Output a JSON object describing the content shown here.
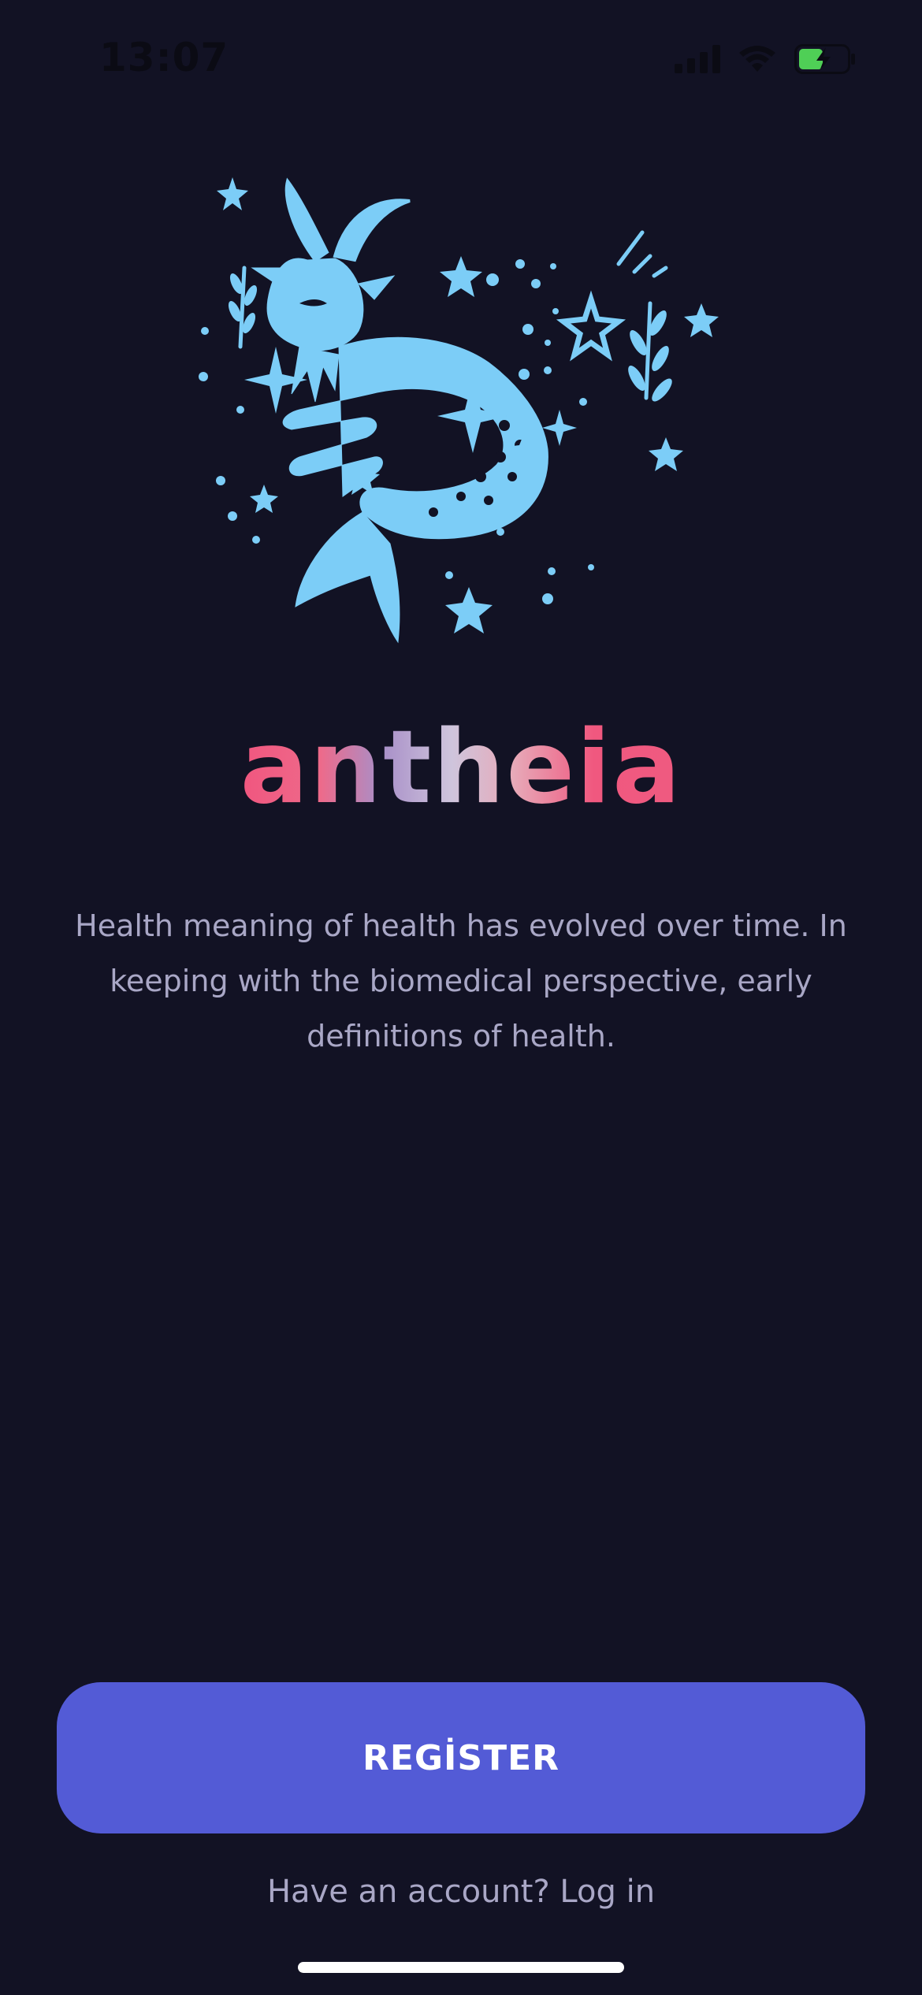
{
  "status_bar": {
    "time": "13:07"
  },
  "brand": {
    "name": "antheia"
  },
  "description": "Health meaning of health has evolved over time. In keeping with the biomedical perspective, early definitions of health.",
  "actions": {
    "register_label": "REGİSTER",
    "login_prompt": "Have an account? Log in"
  },
  "icons": {
    "illustration": "capricorn-sea-goat-icon",
    "signal": "cellular-signal-icon",
    "wifi": "wifi-icon",
    "battery": "battery-charging-icon"
  },
  "colors": {
    "background": "#121224",
    "illustration": "#7ccdf7",
    "button": "#535bd6",
    "text_muted": "#a9a7c6",
    "brand_pink": "#f0567f"
  }
}
